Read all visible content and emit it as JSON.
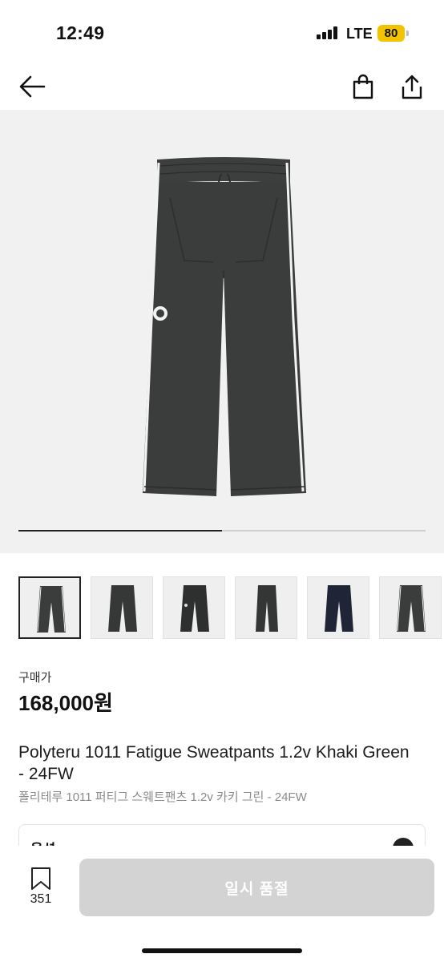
{
  "status_bar": {
    "time": "12:49",
    "network": "LTE",
    "battery": "80"
  },
  "nav": {
    "back_icon": "arrow-left-icon",
    "bag_icon": "shopping-bag-icon",
    "share_icon": "share-icon"
  },
  "gallery": {
    "progress_fraction": 0.5,
    "thumbnail_count": 6,
    "selected_index": 0
  },
  "product": {
    "price_label": "구매가",
    "price": "168,000원",
    "title_en": "Polyteru 1011 Fatigue Sweatpants 1.2v Khaki Green - 24FW",
    "title_ko": "폴리테루 1011 퍼티그 스웨트팬츠 1.2v 카키 그린 - 24FW"
  },
  "option": {
    "label": "옵션"
  },
  "bottom": {
    "wish_count": "351",
    "buy_label": "일시 품절"
  },
  "colors": {
    "accent_battery": "#f2c300",
    "disabled_button": "#d3d3d3",
    "pants_main": "#3a3d3c",
    "pants_navy": "#1f2536"
  }
}
